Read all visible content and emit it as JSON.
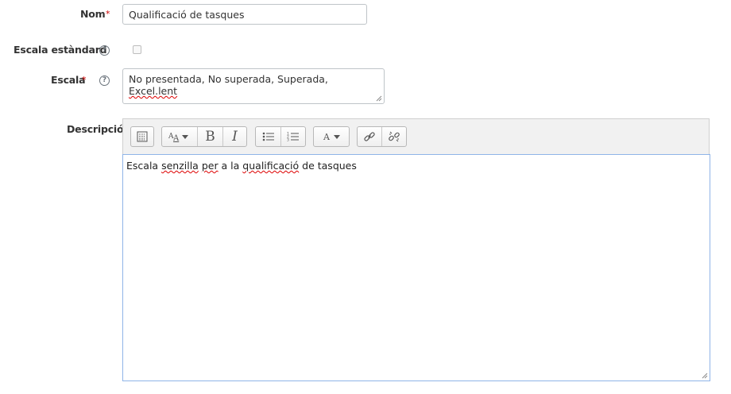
{
  "form": {
    "nom": {
      "label": "Nom",
      "value": "Qualificació de tasques"
    },
    "escala_estandard": {
      "label": "Escala estàndard",
      "checked": false
    },
    "escala": {
      "label": "Escala",
      "value_parts": [
        "No presentada, No superada, Superada, ",
        "Excel.lent"
      ]
    },
    "descripcio": {
      "label": "Descripció",
      "text_parts": [
        "Escala ",
        "senzilla",
        " ",
        "per",
        " a la ",
        "qualificació",
        " de tasques"
      ]
    },
    "required_marker": "*",
    "help_marker": "?"
  },
  "toolbar": {
    "buttons": [
      "show-more-icon",
      "font-style-icon",
      "bold-icon",
      "italic-icon",
      "unordered-list-icon",
      "ordered-list-icon",
      "font-color-icon",
      "link-icon",
      "unlink-icon"
    ],
    "bold_glyph": "B",
    "italic_glyph": "I"
  },
  "colors": {
    "required": "#cc0000",
    "editor_focus_border": "#8fb4e8",
    "toolbar_bg": "#f1f1f1"
  }
}
